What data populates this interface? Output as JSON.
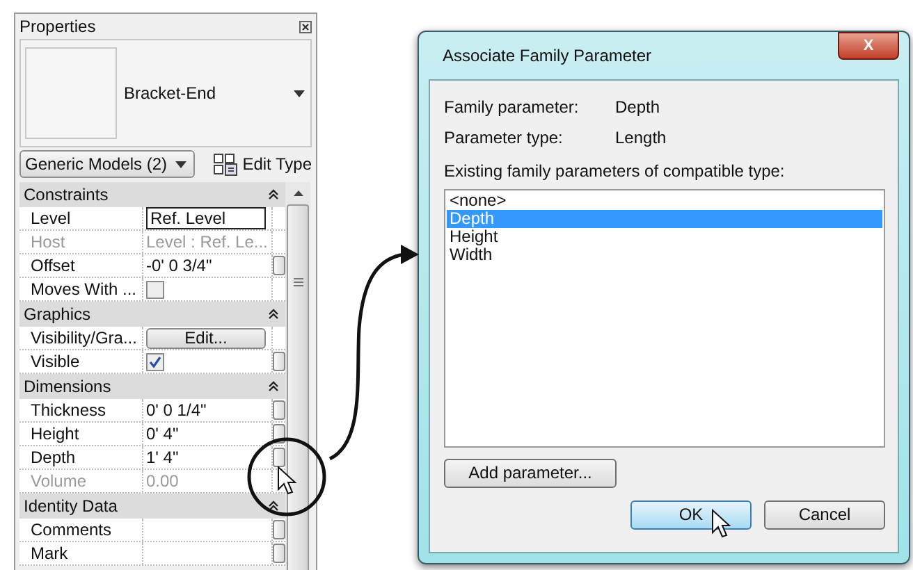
{
  "properties": {
    "title": "Properties",
    "type_name": "Bracket-End",
    "category": "Generic Models (2)",
    "edit_type": "Edit Type",
    "sections": [
      {
        "title": "Constraints",
        "expanded": true,
        "rows": [
          {
            "name": "Level",
            "kind": "edit",
            "value": "Ref. Level",
            "disabled": false,
            "associate_button": false
          },
          {
            "name": "Host",
            "kind": "text",
            "value": "Level : Ref. Le...",
            "disabled": true,
            "associate_button": false
          },
          {
            "name": "Offset",
            "kind": "text",
            "value": "-0'  0 3/4\"",
            "disabled": false,
            "associate_button": true
          },
          {
            "name": "Moves With ...",
            "kind": "checkbox",
            "checked": false,
            "disabled": false,
            "associate_button": false
          }
        ]
      },
      {
        "title": "Graphics",
        "expanded": true,
        "rows": [
          {
            "name": "Visibility/Gra...",
            "kind": "button",
            "value": "Edit...",
            "disabled": false,
            "associate_button": false
          },
          {
            "name": "Visible",
            "kind": "checkbox",
            "checked": true,
            "disabled": false,
            "associate_button": true
          }
        ]
      },
      {
        "title": "Dimensions",
        "expanded": true,
        "rows": [
          {
            "name": "Thickness",
            "kind": "text",
            "value": "0'  0 1/4\"",
            "disabled": false,
            "associate_button": true
          },
          {
            "name": "Height",
            "kind": "text",
            "value": "0'  4\"",
            "disabled": false,
            "associate_button": true
          },
          {
            "name": "Depth",
            "kind": "text",
            "value": "1'  4\"",
            "disabled": false,
            "associate_button": true
          },
          {
            "name": "Volume",
            "kind": "text",
            "value": "0.00",
            "disabled": true,
            "associate_button": false
          }
        ]
      },
      {
        "title": "Identity Data",
        "expanded": true,
        "rows": [
          {
            "name": "Comments",
            "kind": "text",
            "disabled": false,
            "associate_button": true
          },
          {
            "name": "Mark",
            "kind": "text",
            "disabled": false,
            "associate_button": true
          }
        ]
      }
    ]
  },
  "dialog": {
    "title": "Associate Family Parameter",
    "close": "X",
    "fields": [
      {
        "label": "Family parameter:",
        "value": "Depth"
      },
      {
        "label": "Parameter type:",
        "value": "Length"
      }
    ],
    "list_label": "Existing family parameters of compatible type:",
    "items": [
      {
        "label": "<none>",
        "selected": false
      },
      {
        "label": "Depth",
        "selected": true
      },
      {
        "label": "Height",
        "selected": false
      },
      {
        "label": "Width",
        "selected": false
      }
    ],
    "add_button": "Add parameter...",
    "ok_button": "OK",
    "cancel_button": "Cancel"
  }
}
